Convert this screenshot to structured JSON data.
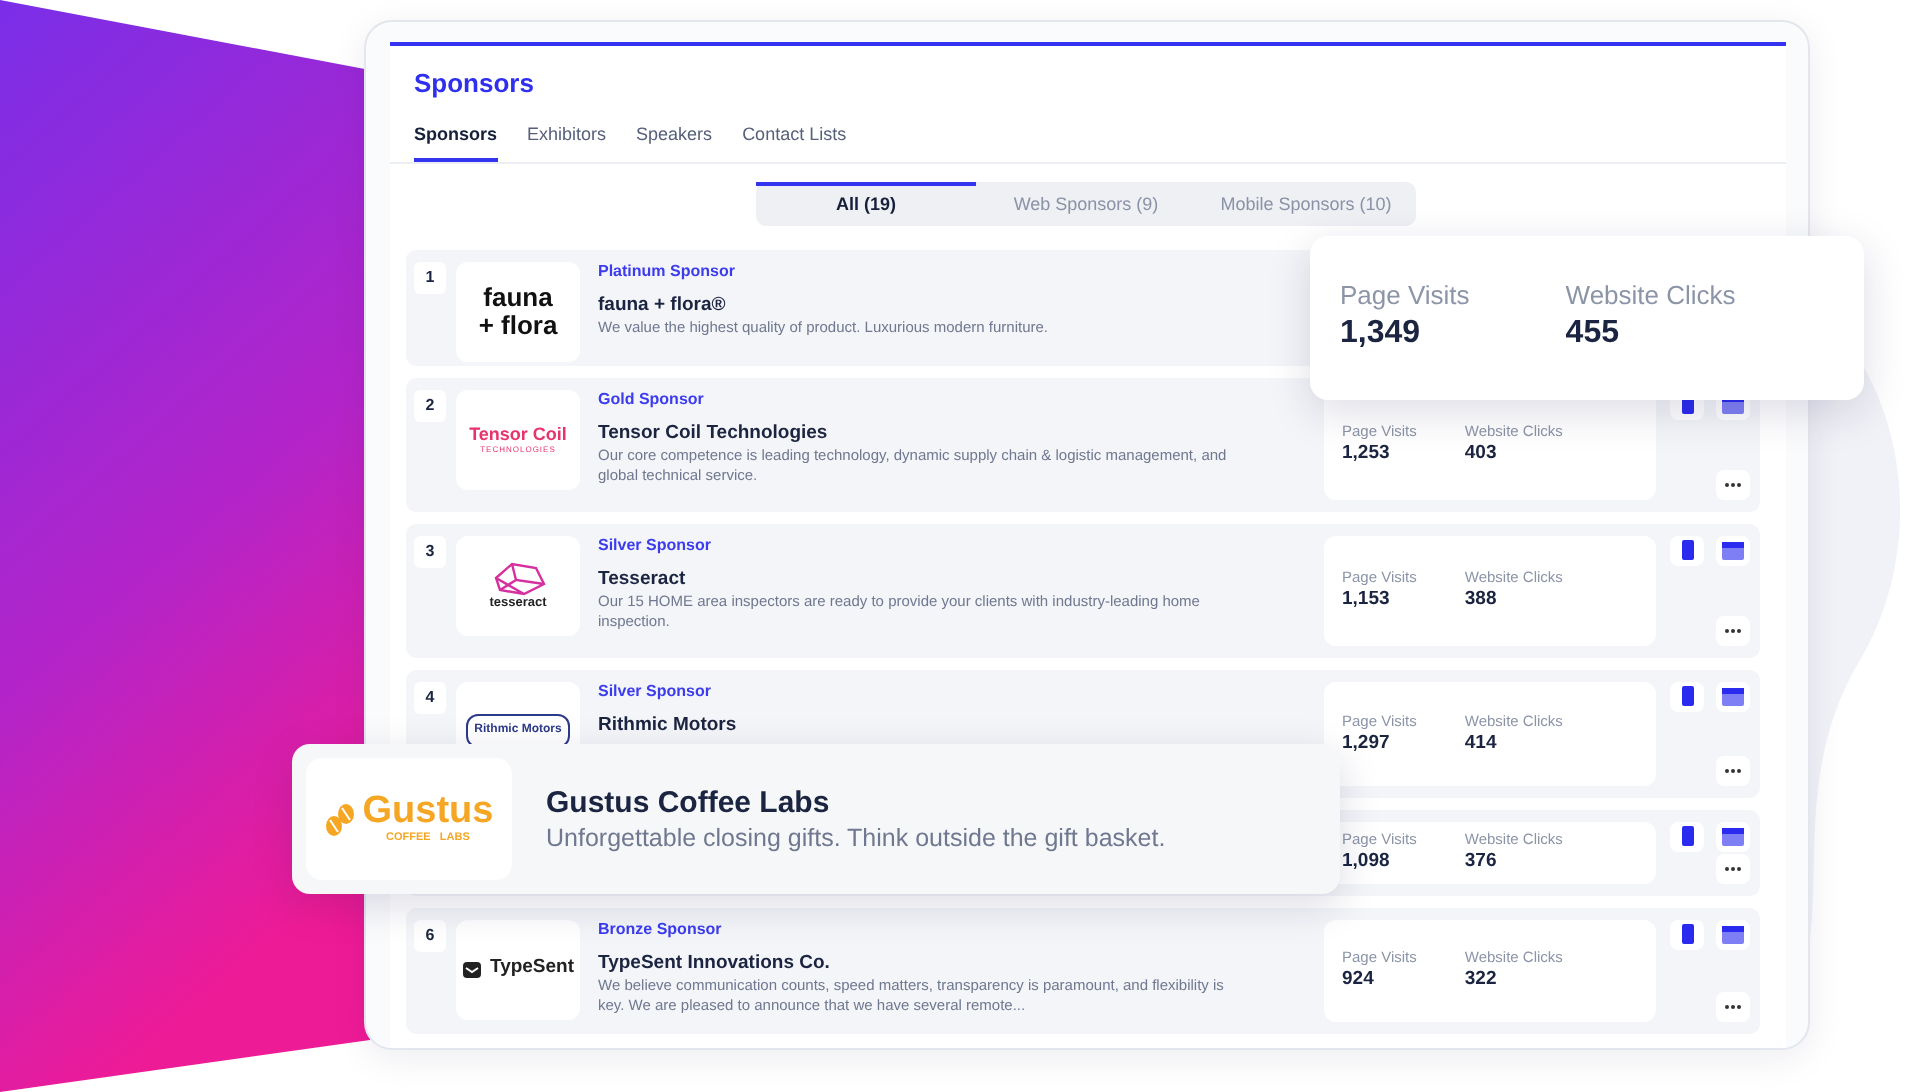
{
  "header": {
    "title": "Sponsors"
  },
  "tabs": [
    {
      "label": "Sponsors",
      "selected": true
    },
    {
      "label": "Exhibitors",
      "selected": false
    },
    {
      "label": "Speakers",
      "selected": false
    },
    {
      "label": "Contact Lists",
      "selected": false
    }
  ],
  "filters": [
    {
      "label": "All (19)",
      "selected": true
    },
    {
      "label": "Web Sponsors (9)",
      "selected": false
    },
    {
      "label": "Mobile Sponsors (10)",
      "selected": false
    }
  ],
  "sponsors": [
    {
      "number": "1",
      "logo": {
        "kind": "wordmark",
        "lines": [
          "fauna",
          "+ flora"
        ]
      },
      "tier": "Platinum Sponsor",
      "name": "fauna + flora®",
      "description": "We value the highest quality of product. Luxurious modern furniture."
    },
    {
      "number": "2",
      "logo": {
        "kind": "striped",
        "lines": [
          "Tensor Coil",
          "TECHNOLOGIES"
        ]
      },
      "tier": "Gold Sponsor",
      "name": "Tensor Coil Technologies",
      "description": "Our core competence is leading technology, dynamic supply chain & logistic management, and global technical service.",
      "stats": [
        {
          "label": "Page Visits",
          "value": "1,253"
        },
        {
          "label": "Website Clicks",
          "value": "403"
        }
      ]
    },
    {
      "number": "3",
      "logo": {
        "kind": "gem",
        "lines": [
          "tesseract"
        ]
      },
      "tier": "Silver Sponsor",
      "name": "Tesseract",
      "description": "Our 15 HOME area inspectors are ready to provide your clients with industry-leading home inspection.",
      "stats": [
        {
          "label": "Page Visits",
          "value": "1,153"
        },
        {
          "label": "Website Clicks",
          "value": "388"
        }
      ]
    },
    {
      "number": "4",
      "logo": {
        "kind": "pill",
        "lines": [
          "Rithmic Motors"
        ]
      },
      "tier": "Silver Sponsor",
      "name": "Rithmic Motors",
      "stats": [
        {
          "label": "Page Visits",
          "value": "1,297"
        },
        {
          "label": "Website Clicks",
          "value": "414"
        }
      ]
    },
    {
      "stats": [
        {
          "label": "Page Visits",
          "value": "1,098"
        },
        {
          "label": "Website Clicks",
          "value": "376"
        }
      ]
    },
    {
      "number": "6",
      "logo": {
        "kind": "envelope",
        "lines": [
          "TypeSent"
        ]
      },
      "tier": "Bronze Sponsor",
      "name": "TypeSent Innovations Co.",
      "description": "We believe communication counts, speed matters, transparency is paramount, and flexibility is key. We are pleased to announce that we have several remote...",
      "stats": [
        {
          "label": "Page Visits",
          "value": "924"
        },
        {
          "label": "Website Clicks",
          "value": "322"
        }
      ]
    }
  ],
  "stats_popup": [
    {
      "label": "Page Visits",
      "value": "1,349"
    },
    {
      "label": "Website Clicks",
      "value": "455"
    }
  ],
  "featured_card": {
    "logo": {
      "kind": "beans",
      "lines": [
        "Gustus",
        "COFFEE   LABS"
      ]
    },
    "name": "Gustus Coffee Labs",
    "tagline": "Unforgettable closing gifts. Think outside the gift basket."
  }
}
